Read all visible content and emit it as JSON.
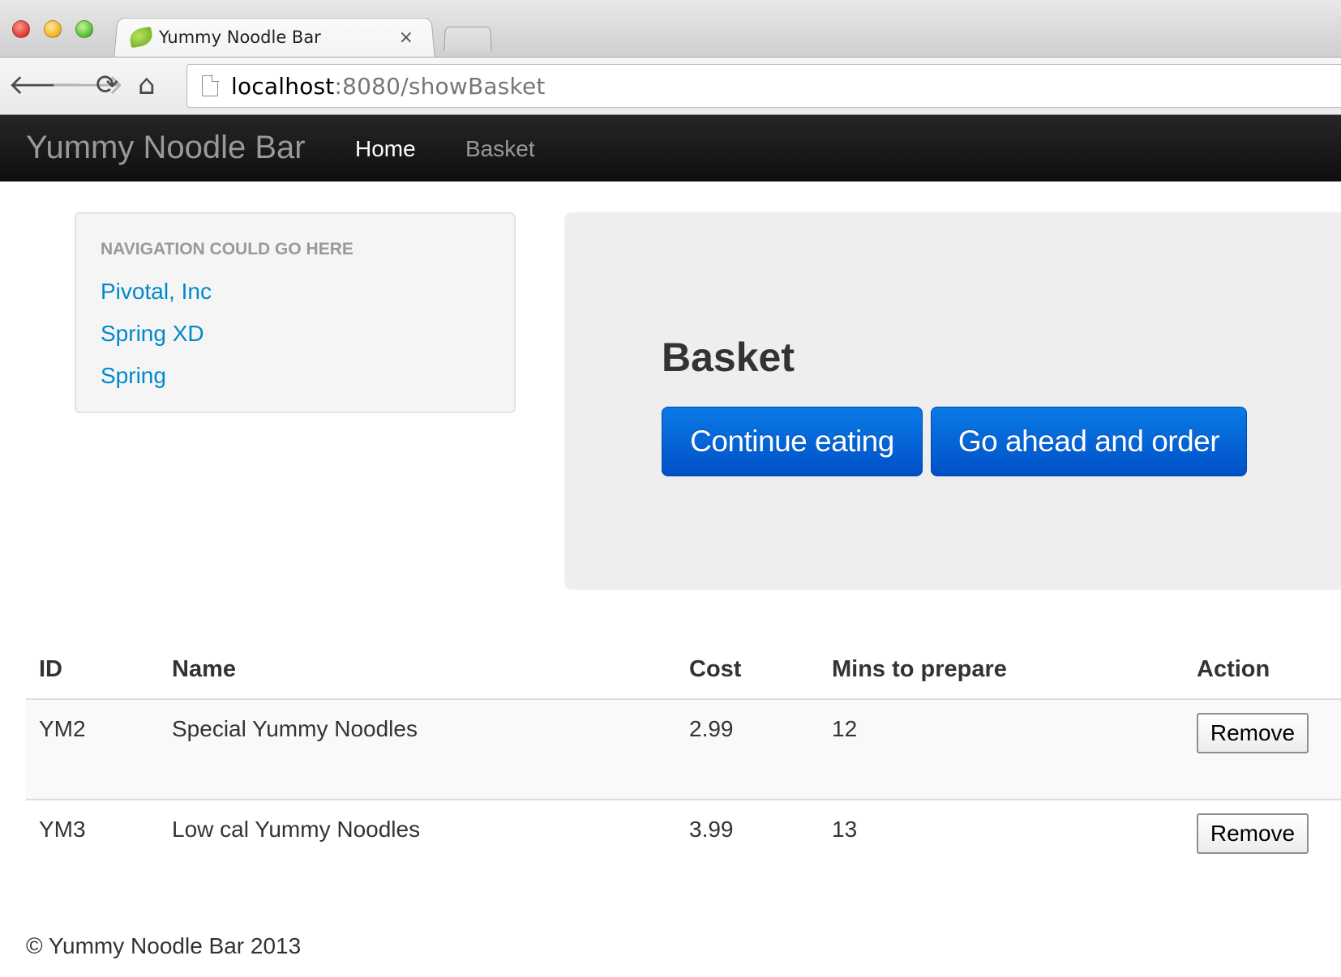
{
  "browser": {
    "tab_title": "Yummy Noodle Bar",
    "tab_close": "×",
    "url_host": "localhost",
    "url_rest": ":8080/showBasket"
  },
  "navbar": {
    "brand": "Yummy Noodle Bar",
    "links": [
      "Home",
      "Basket"
    ],
    "active": "Home"
  },
  "sidebar": {
    "header": "Navigation could go here",
    "links": [
      "Pivotal, Inc",
      "Spring XD",
      "Spring"
    ]
  },
  "hero": {
    "title": "Basket",
    "continue_label": "Continue eating",
    "order_label": "Go ahead and order"
  },
  "table": {
    "headers": [
      "ID",
      "Name",
      "Cost",
      "Mins to prepare",
      "Action"
    ],
    "rows": [
      {
        "id": "YM2",
        "name": "Special Yummy Noodles",
        "cost": "2.99",
        "mins": "12",
        "action": "Remove"
      },
      {
        "id": "YM3",
        "name": "Low cal Yummy Noodles",
        "cost": "3.99",
        "mins": "13",
        "action": "Remove"
      }
    ]
  },
  "footer": {
    "text": "© Yummy Noodle Bar 2013"
  },
  "colors": {
    "link": "#0088cc",
    "primary_button": "#0058d0",
    "navbar_bg": "#1b1b1b"
  }
}
